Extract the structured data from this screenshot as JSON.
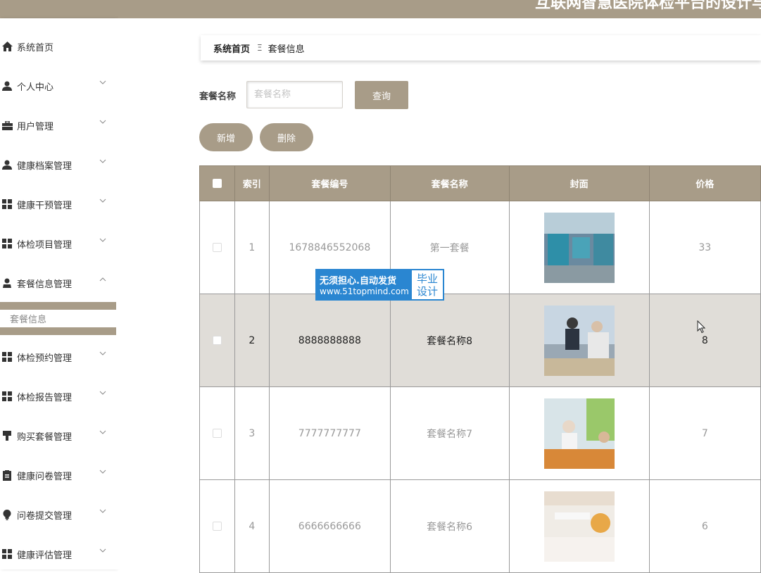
{
  "header": {
    "title": "互联网智慧医院体检平台的设计与实现"
  },
  "sidebar": {
    "items": [
      {
        "label": "系统首页",
        "icon": "home-icon"
      },
      {
        "label": "个人中心",
        "icon": "user-icon"
      },
      {
        "label": "用户管理",
        "icon": "briefcase-icon"
      },
      {
        "label": "健康档案管理",
        "icon": "user-icon"
      },
      {
        "label": "健康干预管理",
        "icon": "grid-icon"
      },
      {
        "label": "体检项目管理",
        "icon": "grid-icon"
      },
      {
        "label": "套餐信息管理",
        "icon": "user-icon"
      },
      {
        "label": "体检预约管理",
        "icon": "grid-icon"
      },
      {
        "label": "体检报告管理",
        "icon": "grid-icon"
      },
      {
        "label": "购买套餐管理",
        "icon": "cart-icon"
      },
      {
        "label": "健康问卷管理",
        "icon": "clipboard-icon"
      },
      {
        "label": "问卷提交管理",
        "icon": "bulb-icon"
      },
      {
        "label": "健康评估管理",
        "icon": "grid-icon"
      }
    ],
    "submenu": {
      "label": "套餐信息"
    }
  },
  "breadcrumb": {
    "home": "系统首页",
    "separator": "Ξ",
    "current": "套餐信息"
  },
  "search": {
    "label": "套餐名称",
    "placeholder": "套餐名称",
    "button": "查询"
  },
  "actions": {
    "add": "新增",
    "delete": "删除"
  },
  "table": {
    "columns": [
      "索引",
      "套餐编号",
      "套餐名称",
      "封面",
      "价格"
    ],
    "rows": [
      {
        "index": "1",
        "code": "1678846552068",
        "name": "第一套餐",
        "price": "33"
      },
      {
        "index": "2",
        "code": "8888888888",
        "name": "套餐名称8",
        "price": "8"
      },
      {
        "index": "3",
        "code": "7777777777",
        "name": "套餐名称7",
        "price": "7"
      },
      {
        "index": "4",
        "code": "6666666666",
        "name": "套餐名称6",
        "price": "6"
      }
    ]
  },
  "watermark": {
    "line1": "无须担心.自动发货",
    "line2": "www.51topmind.com",
    "badge1": "毕业",
    "badge2": "设计"
  },
  "colors": {
    "accent": "#a89c88",
    "highlight_row": "#e0ddd8",
    "watermark_blue": "#2a86d1"
  }
}
